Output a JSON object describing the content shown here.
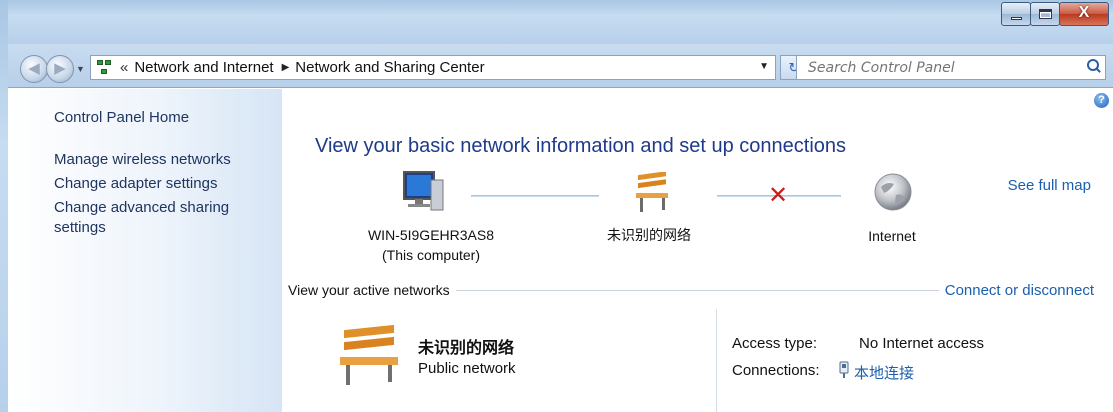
{
  "window": {
    "controls": {
      "minimize_icon": "minimize-icon",
      "maximize_icon": "maximize-icon",
      "close_glyph": "X"
    }
  },
  "nav": {
    "back_glyph": "◀",
    "forward_glyph": "▶",
    "breadcrumb_chevron": "«",
    "breadcrumb": [
      "Network and Internet",
      "Network and Sharing Center"
    ],
    "crumb_separator": "▶",
    "dropdown_glyph": "▼",
    "refresh_glyph": "↻",
    "search_placeholder": "Search Control Panel"
  },
  "sidebar": {
    "items": [
      {
        "label": "Control Panel Home"
      },
      {
        "label": "Manage wireless networks"
      },
      {
        "label": "Change adapter settings"
      },
      {
        "label": "Change advanced sharing settings"
      }
    ]
  },
  "main": {
    "heading": "View your basic network information and set up connections",
    "see_full_map": "See full map",
    "map": {
      "computer": {
        "name": "WIN-5I9GEHR3AS8",
        "subtitle": "(This computer)"
      },
      "network": {
        "name": "未识别的网络"
      },
      "internet": {
        "name": "Internet"
      },
      "broken_link_glyph": "✕"
    },
    "active_networks": {
      "section_label": "View your active networks",
      "connect_link": "Connect or disconnect",
      "network_name": "未识别的网络",
      "network_type": "Public network",
      "access_type_label": "Access type:",
      "access_type_value": "No Internet access",
      "connections_label": "Connections:",
      "connections_value": "本地连接"
    }
  },
  "colors": {
    "link": "#1b5fae",
    "heading": "#1e3a8a",
    "error_x": "#d21a1a"
  }
}
